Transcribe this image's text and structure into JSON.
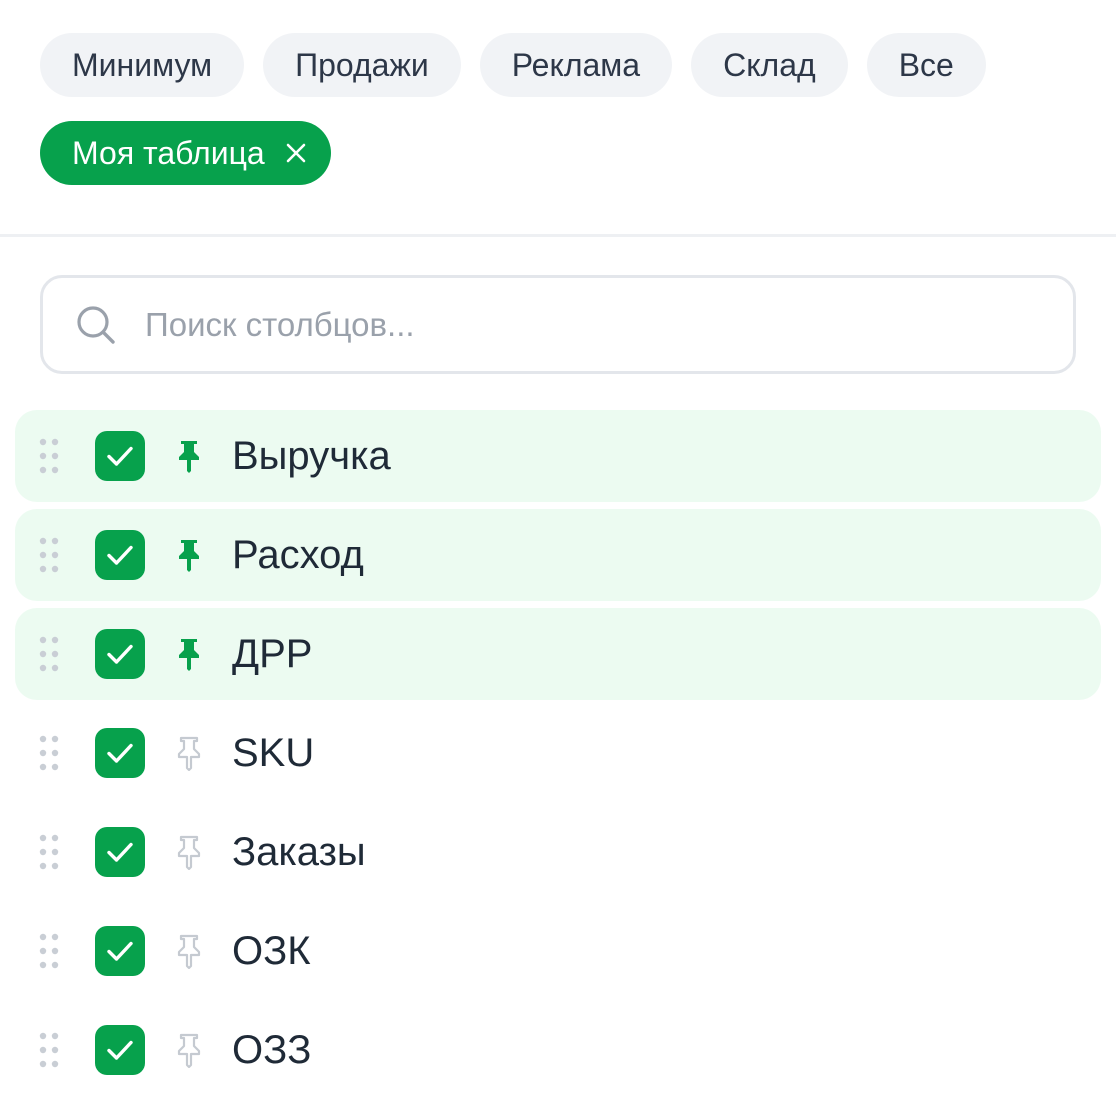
{
  "presets": {
    "row1": [
      "Минимум",
      "Продажи",
      "Реклама",
      "Склад",
      "Все"
    ],
    "active_label": "Моя таблица",
    "active_close_icon": "close-icon"
  },
  "search": {
    "placeholder": "Поиск столбцов...",
    "value": "",
    "icon": "search-icon"
  },
  "columns": [
    {
      "label": "Выручка",
      "checked": true,
      "pinned": true
    },
    {
      "label": "Расход",
      "checked": true,
      "pinned": true
    },
    {
      "label": "ДРР",
      "checked": true,
      "pinned": true
    },
    {
      "label": "SKU",
      "checked": true,
      "pinned": false
    },
    {
      "label": "Заказы",
      "checked": true,
      "pinned": false
    },
    {
      "label": "ОЗК",
      "checked": true,
      "pinned": false
    },
    {
      "label": "ОЗЗ",
      "checked": true,
      "pinned": false
    }
  ],
  "colors": {
    "accent": "#07a14c",
    "pinned_row_bg": "#ecfbf1",
    "chip_bg": "#f1f3f6",
    "pin_inactive": "#c5cad1"
  }
}
